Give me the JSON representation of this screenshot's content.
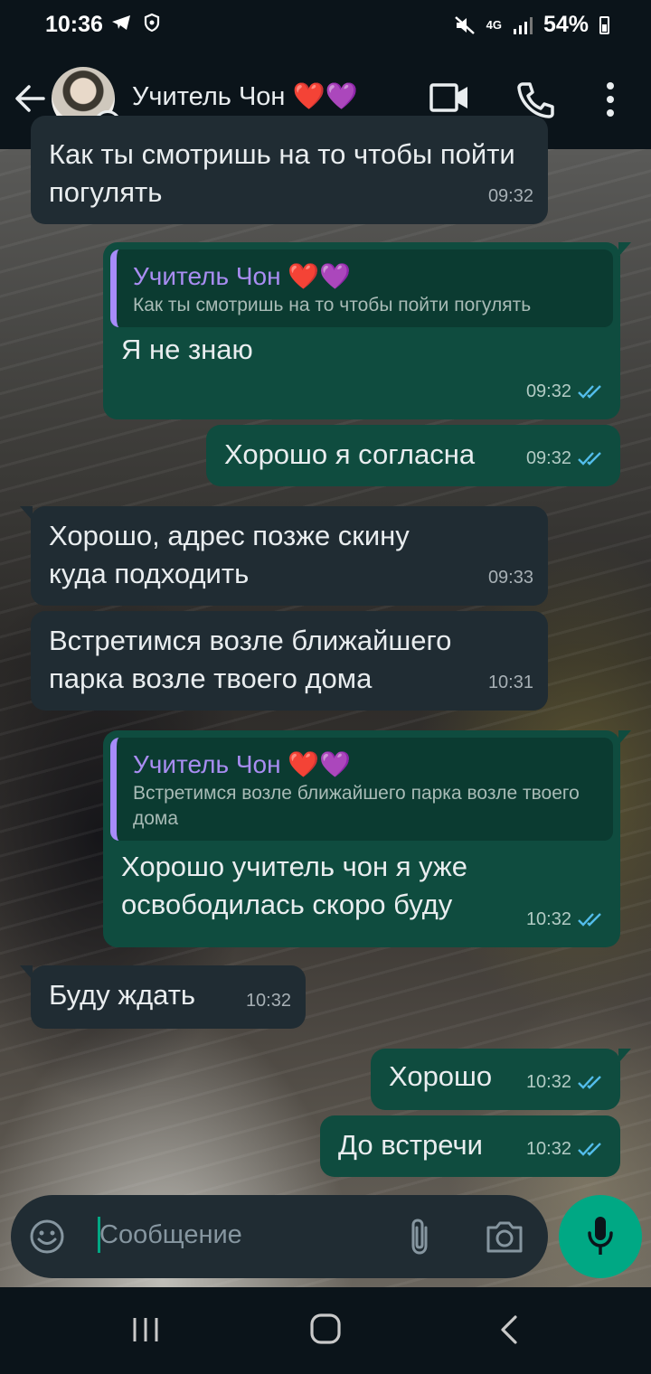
{
  "status_bar": {
    "time": "10:36",
    "network": "4G",
    "battery": "54%"
  },
  "header": {
    "contact_name": "Учитель Чон ❤️💜"
  },
  "messages": [
    {
      "direction": "incoming",
      "text": "Как ты смотришь на то чтобы пойти погулять",
      "time": "09:32"
    },
    {
      "direction": "outgoing",
      "quote_name": "Учитель Чон ❤️💜",
      "quote_text": "Как ты смотришь на то чтобы пойти погулять",
      "text": "Я не знаю",
      "time": "09:32",
      "status": "read"
    },
    {
      "direction": "outgoing",
      "text": "Хорошо я согласна",
      "time": "09:32",
      "status": "read"
    },
    {
      "direction": "incoming",
      "text": "Хорошо, адрес позже скину куда подходить",
      "time": "09:33"
    },
    {
      "direction": "incoming",
      "text": "Встретимся возле ближайшего парка возле твоего дома",
      "time": "10:31"
    },
    {
      "direction": "outgoing",
      "quote_name": "Учитель Чон ❤️💜",
      "quote_text": "Встретимся возле ближайшего парка возле твоего дома",
      "text": "Хорошо учитель чон я уже освободилась скоро буду",
      "time": "10:32",
      "status": "read"
    },
    {
      "direction": "incoming",
      "text": "Буду ждать",
      "time": "10:32"
    },
    {
      "direction": "outgoing",
      "text": "Хорошо",
      "time": "10:32",
      "status": "read"
    },
    {
      "direction": "outgoing",
      "text": "До встречи",
      "time": "10:32",
      "status": "read"
    }
  ],
  "composer": {
    "placeholder": "Сообщение"
  },
  "colors": {
    "background": "#0b141a",
    "incoming_bubble": "#202c33",
    "outgoing_bubble": "#0f4c3f",
    "accent": "#00a884",
    "read_ticks": "#53bdeb",
    "quote_bar": "#a78bfa"
  },
  "icons": [
    "telegram-icon",
    "shield-icon",
    "mute-icon",
    "signal-icon",
    "battery-icon",
    "back-arrow-icon",
    "status-icon",
    "video-call-icon",
    "phone-icon",
    "more-vert-icon",
    "emoji-icon",
    "attach-icon",
    "camera-icon",
    "mic-icon",
    "recent-apps-icon",
    "home-icon",
    "nav-back-icon"
  ]
}
